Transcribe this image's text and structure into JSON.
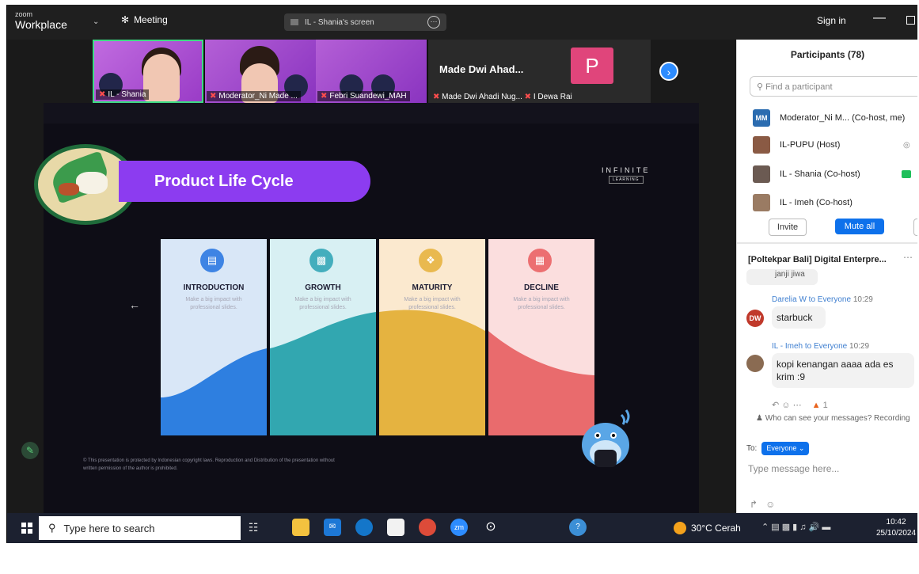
{
  "titlebar": {
    "app_small": "zoom",
    "app_name": "Workplace",
    "meeting_label": "Meeting",
    "screen_label": "IL - Shania's screen",
    "sign_in": "Sign in"
  },
  "strip": {
    "tiles": [
      {
        "label": "IL - Shania"
      },
      {
        "label": "Moderator_Ni Made ..."
      },
      {
        "label": "Febri Suandewi_MAH"
      },
      {
        "label": "Made Dwi Ahadi Nug...",
        "name": "Made Dwi Ahad...",
        "initial": "P",
        "label2": "I Dewa Rai"
      }
    ]
  },
  "slide": {
    "title": "Product Life Cycle",
    "brand": "INFINITE",
    "brand_sub": "LEARNING",
    "stages": [
      {
        "title": "INTRODUCTION",
        "desc": "Make a big impact with professional slides.",
        "color": "#2e7fe0",
        "icon_color": "#3e84e4"
      },
      {
        "title": "GROWTH",
        "desc": "Make a big impact with professional slides.",
        "color": "#32a7b0",
        "icon_color": "#44aebd"
      },
      {
        "title": "MATURITY",
        "desc": "Make a big impact with professional slides.",
        "color": "#e5b340",
        "icon_color": "#e9b94f"
      },
      {
        "title": "DECLINE",
        "desc": "Make a big impact with professional slides.",
        "color": "#e96b6d",
        "icon_color": "#ec6f71"
      }
    ],
    "copyright": "© This presentation is protected by Indonesian copyright laws. Reproduction and Distribution of the presentation without written permission of the author is prohibited."
  },
  "participants": {
    "title": "Participants (78)",
    "search_placeholder": "Find a participant",
    "rows": [
      {
        "initials": "MM",
        "name": "Moderator_Ni M... (Co-host, me)",
        "color": "#2b6cb0"
      },
      {
        "initials": "",
        "name": "IL-PUPU (Host)",
        "color": "#8a5a44"
      },
      {
        "initials": "",
        "name": "IL - Shania (Co-host)",
        "color": "#6b5a52"
      },
      {
        "initials": "",
        "name": "IL - Imeh (Co-host)",
        "color": "#9a7b63"
      }
    ],
    "invite": "Invite",
    "mute_all": "Mute all"
  },
  "chat": {
    "title": "[Poltekpar Bali] Digital Enterpre...",
    "prev_text": "janji jiwa",
    "messages": [
      {
        "from": "Darelia W to Everyone",
        "time": "10:29",
        "text": "starbuck",
        "initials": "DW",
        "color": "#c0392b"
      },
      {
        "from": "IL - Imeh to Everyone",
        "time": "10:29",
        "text": "kopi kenangan aaaa ada es krim :9",
        "initials": "",
        "color": "#8a6b52"
      }
    ],
    "reaction_count": "1",
    "who_can_see": "Who can see your messages? Recording",
    "to_label": "To:",
    "to_value": "Everyone",
    "input_placeholder": "Type message here..."
  },
  "taskbar": {
    "search_placeholder": "Type here to search",
    "weather": "30°C Cerah",
    "time": "10:42",
    "date": "25/10/2024"
  }
}
